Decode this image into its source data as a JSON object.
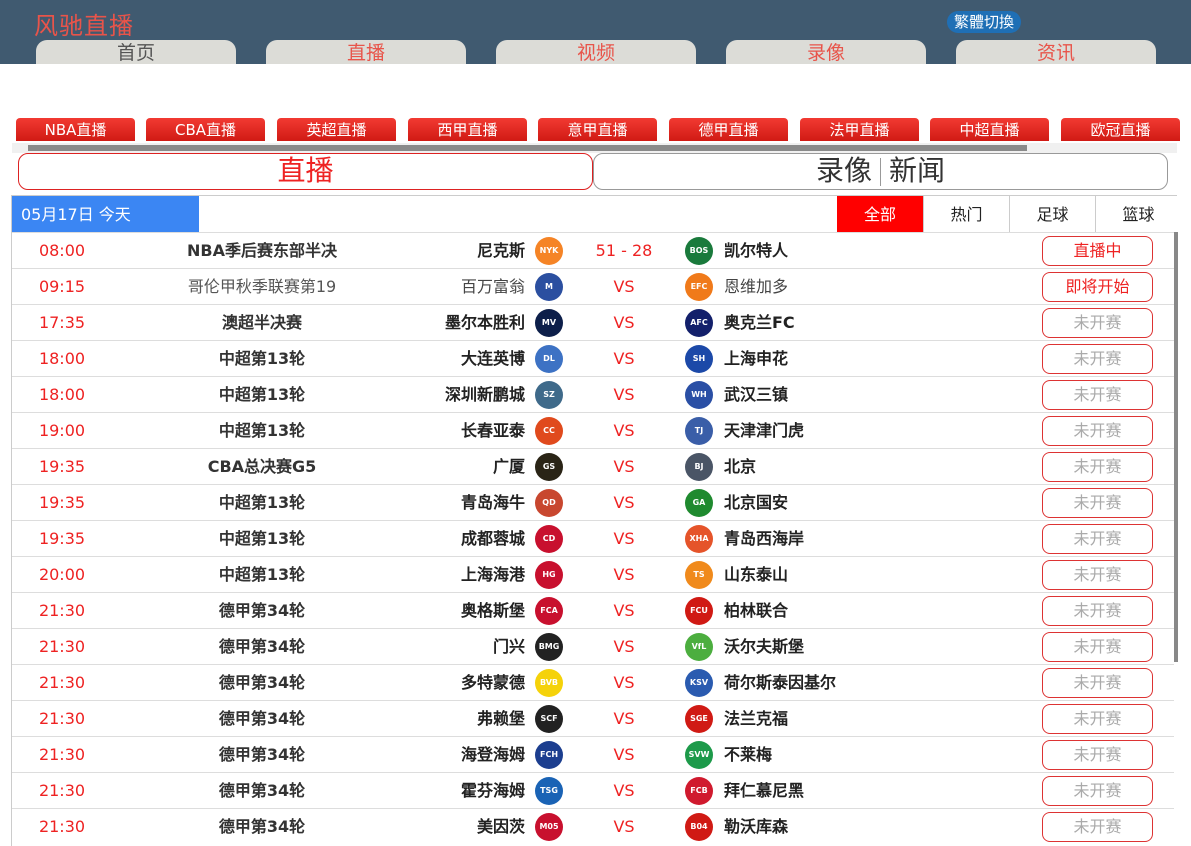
{
  "site": {
    "logo": "风驰直播",
    "lang_switch": "繁體切換"
  },
  "nav": [
    "首页",
    "直播",
    "视频",
    "录像",
    "资讯"
  ],
  "sports": [
    "NBA直播",
    "CBA直播",
    "英超直播",
    "西甲直播",
    "意甲直播",
    "德甲直播",
    "法甲直播",
    "中超直播",
    "欧冠直播"
  ],
  "tabs": {
    "live": "直播",
    "replay": "录像",
    "news": "新闻"
  },
  "schedule": {
    "date": "05月17日 今天",
    "filters": [
      "全部",
      "热门",
      "足球",
      "篮球"
    ],
    "active_filter": "全部",
    "matches": [
      {
        "time": "08:00",
        "league": "NBA季后赛东部半决",
        "home": "尼克斯",
        "home_logo": "NYK",
        "home_color": "#f58426",
        "score": "51 - 28",
        "away": "凯尔特人",
        "away_logo": "BOS",
        "away_color": "#1a7a3c",
        "status": "直播中"
      },
      {
        "time": "09:15",
        "league": "哥伦甲秋季联赛第19",
        "home": "百万富翁",
        "home_logo": "M",
        "home_color": "#2b4fa0",
        "score": "VS",
        "away": "恩维加多",
        "away_logo": "EFC",
        "away_color": "#f07a1a",
        "status": "即将开始"
      },
      {
        "time": "17:35",
        "league": "澳超半决赛",
        "home": "墨尔本胜利",
        "home_logo": "MV",
        "home_color": "#0d1f4a",
        "score": "VS",
        "away": "奥克兰FC",
        "away_logo": "AFC",
        "away_color": "#13206b",
        "status": "未开赛"
      },
      {
        "time": "18:00",
        "league": "中超第13轮",
        "home": "大连英博",
        "home_logo": "DL",
        "home_color": "#3d72c4",
        "score": "VS",
        "away": "上海申花",
        "away_logo": "SH",
        "away_color": "#1c49a8",
        "status": "未开赛"
      },
      {
        "time": "18:00",
        "league": "中超第13轮",
        "home": "深圳新鹏城",
        "home_logo": "SZ",
        "home_color": "#3f6a8a",
        "score": "VS",
        "away": "武汉三镇",
        "away_logo": "WH",
        "away_color": "#2a4fa5",
        "status": "未开赛"
      },
      {
        "time": "19:00",
        "league": "中超第13轮",
        "home": "长春亚泰",
        "home_logo": "CC",
        "home_color": "#e04a1d",
        "score": "VS",
        "away": "天津津门虎",
        "away_logo": "TJ",
        "away_color": "#3a5ea8",
        "status": "未开赛"
      },
      {
        "time": "19:35",
        "league": "CBA总决赛G5",
        "home": "广厦",
        "home_logo": "GS",
        "home_color": "#2a2416",
        "score": "VS",
        "away": "北京",
        "away_logo": "BJ",
        "away_color": "#4a5566",
        "status": "未开赛"
      },
      {
        "time": "19:35",
        "league": "中超第13轮",
        "home": "青岛海牛",
        "home_logo": "QD",
        "home_color": "#c8472f",
        "score": "VS",
        "away": "北京国安",
        "away_logo": "GA",
        "away_color": "#1f8a2f",
        "status": "未开赛"
      },
      {
        "time": "19:35",
        "league": "中超第13轮",
        "home": "成都蓉城",
        "home_logo": "CD",
        "home_color": "#c8102e",
        "score": "VS",
        "away": "青岛西海岸",
        "away_logo": "XHA",
        "away_color": "#e5542a",
        "status": "未开赛"
      },
      {
        "time": "20:00",
        "league": "中超第13轮",
        "home": "上海海港",
        "home_logo": "HG",
        "home_color": "#c8102e",
        "score": "VS",
        "away": "山东泰山",
        "away_logo": "TS",
        "away_color": "#f08a1c",
        "status": "未开赛"
      },
      {
        "time": "21:30",
        "league": "德甲第34轮",
        "home": "奥格斯堡",
        "home_logo": "FCA",
        "home_color": "#c8102e",
        "score": "VS",
        "away": "柏林联合",
        "away_logo": "FCU",
        "away_color": "#d01a14",
        "status": "未开赛"
      },
      {
        "time": "21:30",
        "league": "德甲第34轮",
        "home": "门兴",
        "home_logo": "BMG",
        "home_color": "#222222",
        "score": "VS",
        "away": "沃尔夫斯堡",
        "away_logo": "VfL",
        "away_color": "#4cae3f",
        "status": "未开赛"
      },
      {
        "time": "21:30",
        "league": "德甲第34轮",
        "home": "多特蒙德",
        "home_logo": "BVB",
        "home_color": "#f5d20a",
        "score": "VS",
        "away": "荷尔斯泰因基尔",
        "away_logo": "KSV",
        "away_color": "#2a5bb0",
        "status": "未开赛"
      },
      {
        "time": "21:30",
        "league": "德甲第34轮",
        "home": "弗赖堡",
        "home_logo": "SCF",
        "home_color": "#222222",
        "score": "VS",
        "away": "法兰克福",
        "away_logo": "SGE",
        "away_color": "#d01a14",
        "status": "未开赛"
      },
      {
        "time": "21:30",
        "league": "德甲第34轮",
        "home": "海登海姆",
        "home_logo": "FCH",
        "home_color": "#1c3e8f",
        "score": "VS",
        "away": "不莱梅",
        "away_logo": "SVW",
        "away_color": "#1d9a4a",
        "status": "未开赛"
      },
      {
        "time": "21:30",
        "league": "德甲第34轮",
        "home": "霍芬海姆",
        "home_logo": "TSG",
        "home_color": "#1a63b5",
        "score": "VS",
        "away": "拜仁慕尼黑",
        "away_logo": "FCB",
        "away_color": "#d01a2e",
        "status": "未开赛"
      },
      {
        "time": "21:30",
        "league": "德甲第34轮",
        "home": "美因茨",
        "home_logo": "M05",
        "home_color": "#c8102e",
        "score": "VS",
        "away": "勒沃库森",
        "away_logo": "B04",
        "away_color": "#d01a14",
        "status": "未开赛"
      }
    ]
  }
}
